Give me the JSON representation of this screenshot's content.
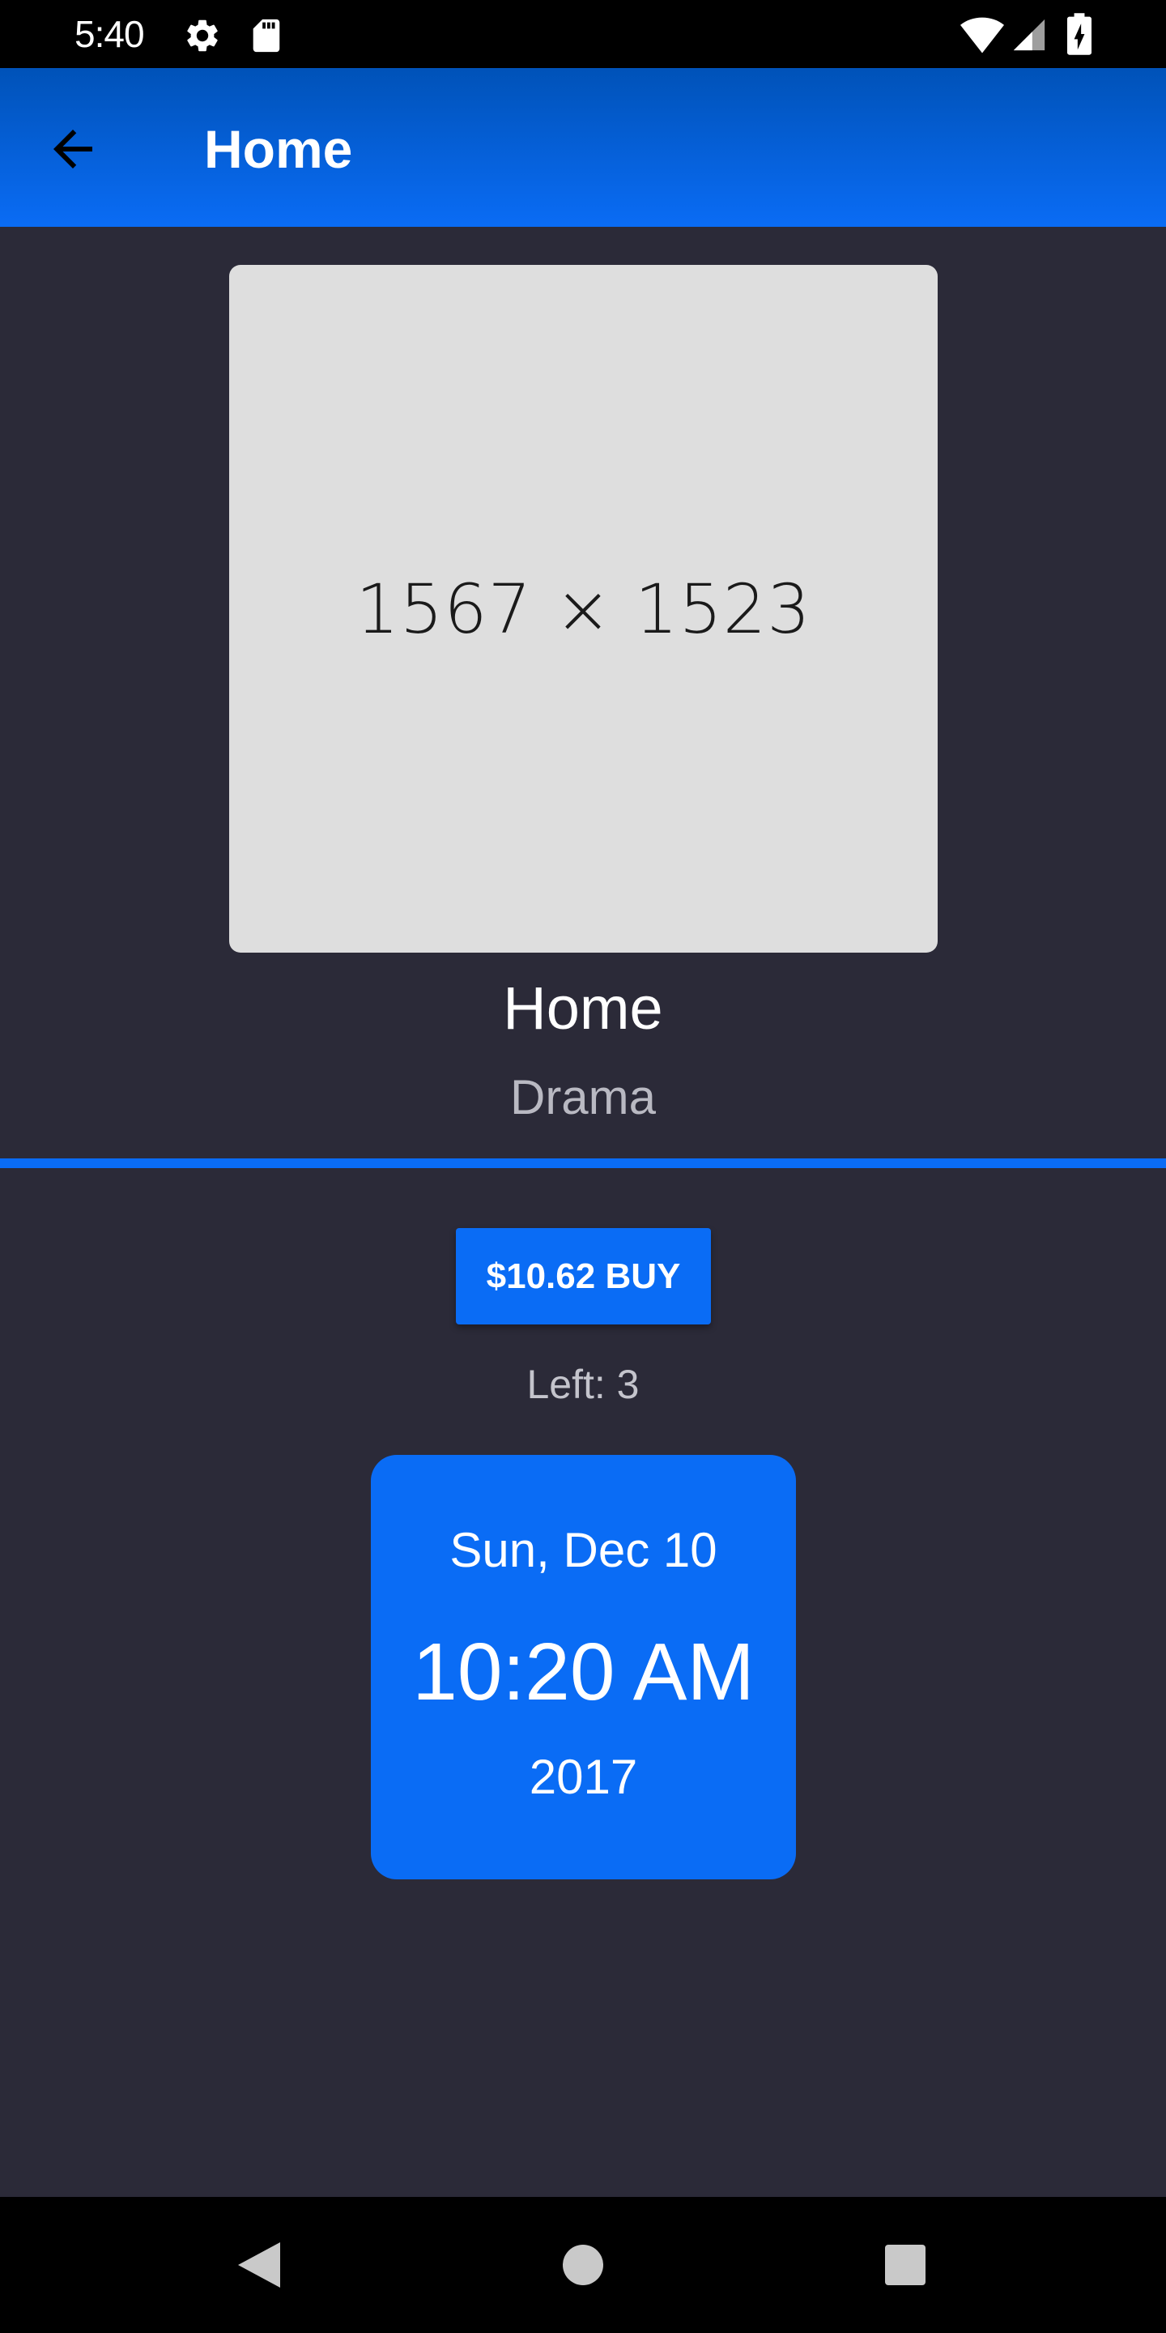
{
  "status_bar": {
    "time": "5:40",
    "icons": [
      "settings-icon",
      "sd-card-icon",
      "wifi-icon",
      "signal-icon",
      "battery-charging-icon"
    ]
  },
  "app_bar": {
    "title": "Home",
    "back_icon": "arrow-left-icon"
  },
  "poster": {
    "placeholder_label": "1567 × 1523"
  },
  "movie": {
    "title": "Home",
    "genre": "Drama"
  },
  "purchase": {
    "buy_label": "$10.62 BUY",
    "stock_label": "Left: 3"
  },
  "showtime": {
    "date": "Sun, Dec 10",
    "time": "10:20 AM",
    "year": "2017"
  },
  "nav_bar": {
    "buttons": [
      "back-triangle-icon",
      "home-circle-icon",
      "recents-square-icon"
    ]
  },
  "colors": {
    "accent": "#0a6cf5",
    "app_bar_top": "#0052b8",
    "background": "#2b2a38",
    "placeholder": "#dedede"
  }
}
